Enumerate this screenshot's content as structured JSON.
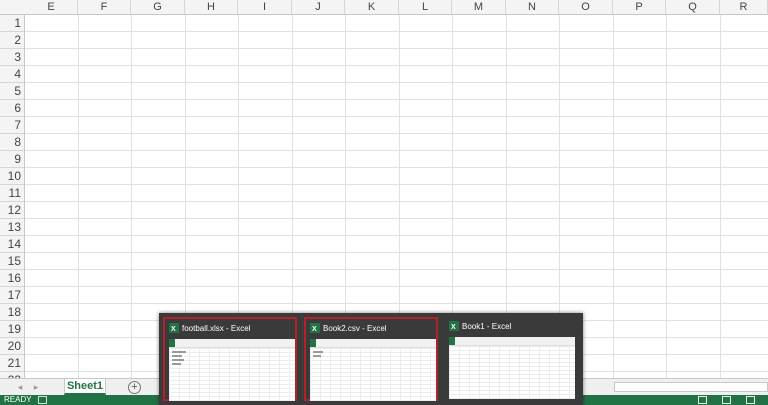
{
  "columns": [
    "E",
    "F",
    "G",
    "H",
    "I",
    "J",
    "K",
    "L",
    "M",
    "N",
    "O",
    "P",
    "Q",
    "R"
  ],
  "rows": [
    "1",
    "2",
    "3",
    "4",
    "5",
    "6",
    "7",
    "8",
    "9",
    "10",
    "11",
    "12",
    "13",
    "14",
    "15",
    "16",
    "17",
    "18",
    "19",
    "20",
    "21",
    "22"
  ],
  "sheet_tab": {
    "label": "Sheet1"
  },
  "add_sheet_symbol": "+",
  "nav_arrows": {
    "prev": "◂",
    "next": "▸"
  },
  "status": {
    "text": "READY"
  },
  "colors": {
    "excel_green": "#217346",
    "active_border": "#b0232a",
    "popup_bg": "#3a3a3a"
  },
  "taskbar_previews": [
    {
      "title": "football.xlsx - Excel",
      "active": true,
      "icon": "excel-icon"
    },
    {
      "title": "Book2.csv - Excel",
      "active": true,
      "icon": "excel-icon"
    },
    {
      "title": "Book1 - Excel",
      "active": false,
      "icon": "excel-icon"
    }
  ]
}
